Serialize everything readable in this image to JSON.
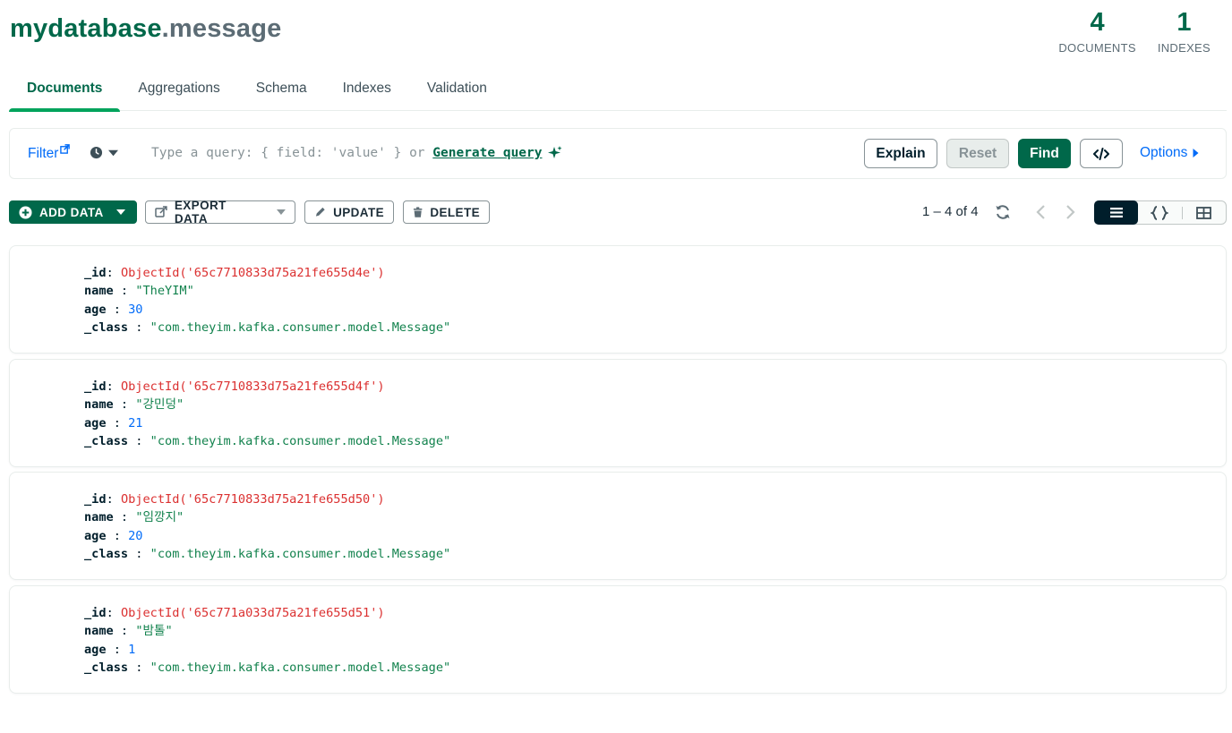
{
  "header": {
    "database": "mydatabase",
    "collection": ".message"
  },
  "stats": {
    "documents_value": "4",
    "documents_label": "DOCUMENTS",
    "indexes_value": "1",
    "indexes_label": "INDEXES"
  },
  "tabs": [
    {
      "label": "Documents",
      "active": true
    },
    {
      "label": "Aggregations",
      "active": false
    },
    {
      "label": "Schema",
      "active": false
    },
    {
      "label": "Indexes",
      "active": false
    },
    {
      "label": "Validation",
      "active": false
    }
  ],
  "querybar": {
    "filter_label": "Filter",
    "placeholder_prefix": "Type a query: { field: 'value' } or ",
    "generate_query": "Generate query",
    "explain": "Explain",
    "reset": "Reset",
    "find": "Find",
    "options": "Options"
  },
  "toolbar": {
    "add_data": "ADD DATA",
    "export_data": "EXPORT DATA",
    "update": "UPDATE",
    "delete": "DELETE",
    "pagination": "1 – 4 of 4"
  },
  "documents": [
    {
      "id_key": "_id",
      "id_value": "ObjectId('65c7710833d75a21fe655d4e')",
      "name_key": "name",
      "name_value": "\"TheYIM\"",
      "age_key": "age",
      "age_value": "30",
      "class_key": "_class",
      "class_value": "\"com.theyim.kafka.consumer.model.Message\""
    },
    {
      "id_key": "_id",
      "id_value": "ObjectId('65c7710833d75a21fe655d4f')",
      "name_key": "name",
      "name_value": "\"강민덩\"",
      "age_key": "age",
      "age_value": "21",
      "class_key": "_class",
      "class_value": "\"com.theyim.kafka.consumer.model.Message\""
    },
    {
      "id_key": "_id",
      "id_value": "ObjectId('65c7710833d75a21fe655d50')",
      "name_key": "name",
      "name_value": "\"임깡지\"",
      "age_key": "age",
      "age_value": "20",
      "class_key": "_class",
      "class_value": "\"com.theyim.kafka.consumer.model.Message\""
    },
    {
      "id_key": "_id",
      "id_value": "ObjectId('65c771a033d75a21fe655d51')",
      "name_key": "name",
      "name_value": "\"밤톨\"",
      "age_key": "age",
      "age_value": "1",
      "class_key": "_class",
      "class_value": "\"com.theyim.kafka.consumer.model.Message\""
    }
  ],
  "colors": {
    "brand_green": "#00684a",
    "accent_green": "#00a35c",
    "link_blue": "#016bf8",
    "objectid_red": "#db3030",
    "string_green": "#12824d",
    "number_blue": "#016bf8"
  },
  "icons": [
    "external-link-icon",
    "clock-icon",
    "caret-down-icon",
    "sparkle-icon",
    "code-icon",
    "caret-right-icon",
    "plus-circle-icon",
    "export-icon",
    "pencil-icon",
    "trash-icon",
    "refresh-icon",
    "chevron-left-icon",
    "chevron-right-icon",
    "list-view-icon",
    "json-view-icon",
    "table-view-icon"
  ]
}
